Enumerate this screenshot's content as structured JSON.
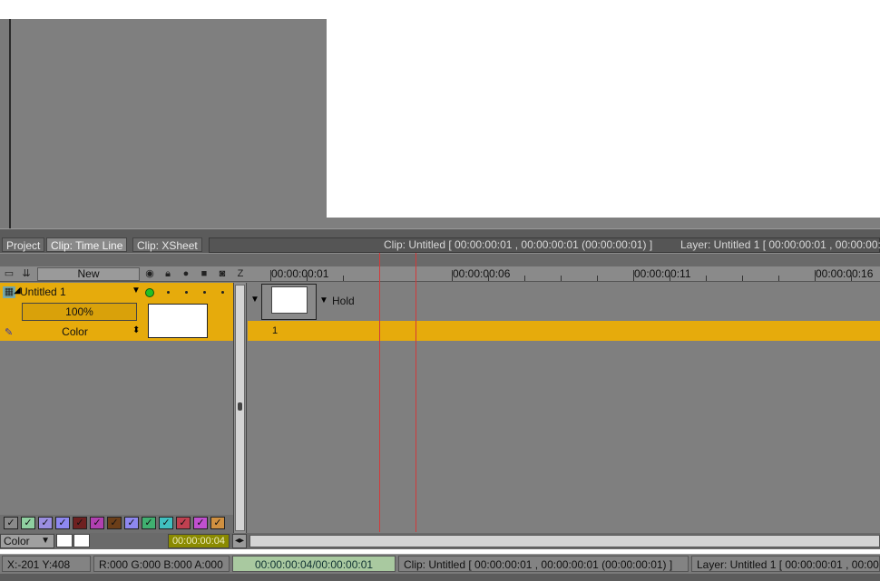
{
  "tabs": [
    {
      "label": "Project",
      "active": false
    },
    {
      "label": "Clip: Time Line",
      "active": true
    },
    {
      "label": "Clip: XSheet",
      "active": false
    }
  ],
  "tab_info": {
    "clip": "Clip: Untitled [ 00:00:00:01 , 00:00:00:01  (00:00:00:01) ]",
    "layer": "Layer: Untitled 1 [ 00:00:00:01 , 00:00:00:01"
  },
  "layer_toolbar": {
    "new_label": "New",
    "z_label": "Z"
  },
  "layer": {
    "name": "Untitled 1",
    "opacity": "100%",
    "blend": "Color"
  },
  "ruler": {
    "labels": [
      "00:00:00:01",
      "00:00:00:06",
      "00:00:00:11",
      "00:00:00:16"
    ]
  },
  "track": {
    "hold_label": "Hold",
    "frame_number": "1"
  },
  "swatches": [
    {
      "color": "#8a8a8a"
    },
    {
      "color": "#8fd0a0"
    },
    {
      "color": "#9a8ee0"
    },
    {
      "color": "#8e88f0"
    },
    {
      "color": "#6e2020"
    },
    {
      "color": "#b040b0"
    },
    {
      "color": "#6b3e18"
    },
    {
      "color": "#8e88f0"
    },
    {
      "color": "#40b070"
    },
    {
      "color": "#40c0c0"
    },
    {
      "color": "#c04050"
    },
    {
      "color": "#c050d0"
    },
    {
      "color": "#d09040"
    }
  ],
  "bottom": {
    "color_mode": "Color",
    "current_time": "00:00:00:04"
  },
  "status": {
    "coords": "X:-201  Y:408",
    "rgba": "R:000 G:000 B:000 A:000",
    "time": "00:00:00:04/00:00:00:01",
    "clip": "Clip: Untitled [ 00:00:00:01 , 00:00:00:01  (00:00:00:01) ]",
    "layer": "Layer: Untitled 1 [ 00:00:00:01 , 00:00:00"
  }
}
